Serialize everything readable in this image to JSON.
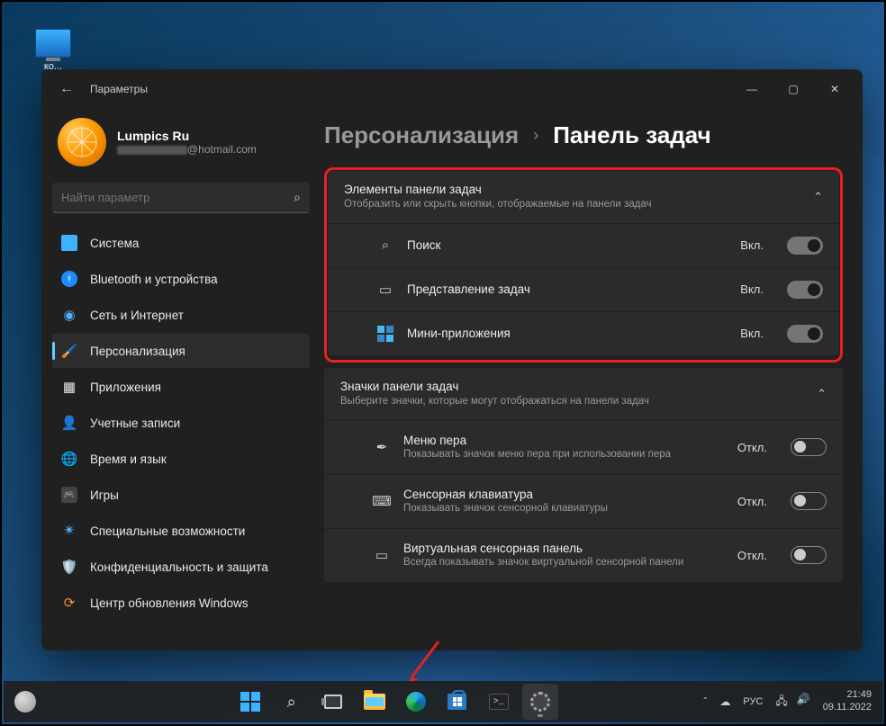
{
  "desktop": {
    "pc_label": "ко..."
  },
  "window": {
    "title": "Параметры",
    "account": {
      "name": "Lumpics Ru",
      "email_suffix": "@hotmail.com"
    },
    "search_placeholder": "Найти параметр",
    "nav": [
      {
        "key": "system",
        "label": "Система"
      },
      {
        "key": "bt",
        "label": "Bluetooth и устройства"
      },
      {
        "key": "net",
        "label": "Сеть и Интернет"
      },
      {
        "key": "pers",
        "label": "Персонализация",
        "active": true
      },
      {
        "key": "apps",
        "label": "Приложения"
      },
      {
        "key": "accounts",
        "label": "Учетные записи"
      },
      {
        "key": "time",
        "label": "Время и язык"
      },
      {
        "key": "gaming",
        "label": "Игры"
      },
      {
        "key": "access",
        "label": "Специальные возможности"
      },
      {
        "key": "priv",
        "label": "Конфиденциальность и защита"
      },
      {
        "key": "update",
        "label": "Центр обновления Windows"
      }
    ],
    "breadcrumb": {
      "parent": "Персонализация",
      "current": "Панель задач"
    },
    "section1": {
      "title": "Элементы панели задач",
      "desc": "Отобразить или скрыть кнопки, отображаемые на панели задач",
      "rows": [
        {
          "label": "Поиск",
          "state": "Вкл."
        },
        {
          "label": "Представление задач",
          "state": "Вкл."
        },
        {
          "label": "Мини-приложения",
          "state": "Вкл."
        }
      ]
    },
    "section2": {
      "title": "Значки панели задач",
      "desc": "Выберите значки, которые могут отображаться на панели задач",
      "rows": [
        {
          "label": "Меню пера",
          "desc": "Показывать значок меню пера при использовании пера",
          "state": "Откл."
        },
        {
          "label": "Сенсорная клавиатура",
          "desc": "Показывать значок сенсорной клавиатуры",
          "state": "Откл."
        },
        {
          "label": "Виртуальная сенсорная панель",
          "desc": "Всегда показывать значок виртуальной сенсорной панели",
          "state": "Откл."
        }
      ]
    }
  },
  "taskbar": {
    "lang": "РУС",
    "time": "21:49",
    "date": "09.11.2022"
  }
}
